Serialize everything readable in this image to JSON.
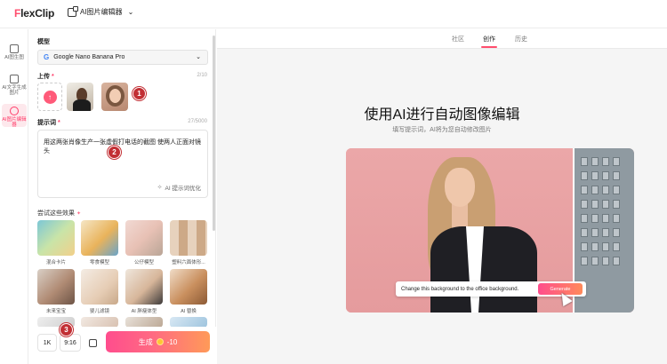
{
  "header": {
    "logo_text": "FlexClip",
    "tool_name": "AI图片编辑器"
  },
  "rail": {
    "items": [
      {
        "label": "AI图生图"
      },
      {
        "label": "AI文字生成图片"
      },
      {
        "label": "AI图片编辑器"
      }
    ]
  },
  "panel": {
    "model_label": "模型",
    "model_value": "Google Nano Banana Pro",
    "upload_label": "上传",
    "upload_count": "2/10",
    "prompt_label": "提示词",
    "prompt_count": "27/5000",
    "prompt_text": "用这两张肖像生产一张虚假打电话的截图 使两人正面对镜头",
    "ai_optimize": "AI 提示词优化",
    "effects_label": "尝试这些效果",
    "effects": [
      {
        "label": "混合卡片"
      },
      {
        "label": "零食模型"
      },
      {
        "label": "公仔模型"
      },
      {
        "label": "塑料六面体形..."
      },
      {
        "label": "未来宝宝"
      },
      {
        "label": "婴儿滤镜"
      },
      {
        "label": "AI 胖瘦体型"
      },
      {
        "label": "AI 替换"
      }
    ],
    "resolution_btn": "1K",
    "ratio_btn": "9:16",
    "generate_label": "生成",
    "generate_cost": "-10"
  },
  "markers": [
    "1",
    "2",
    "3"
  ],
  "main": {
    "tabs": [
      {
        "label": "社区"
      },
      {
        "label": "创作"
      },
      {
        "label": "历史"
      }
    ],
    "active_tab": "创作",
    "title": "使用AI进行自动图像编辑",
    "subtitle": "填写提示词，AI将为您自动修改图片",
    "hero_prompt": "Change this background to the office background.",
    "hero_generate": "Generate"
  },
  "colors": {
    "accent": "#ff4d6d",
    "marker": "#c22f34"
  }
}
